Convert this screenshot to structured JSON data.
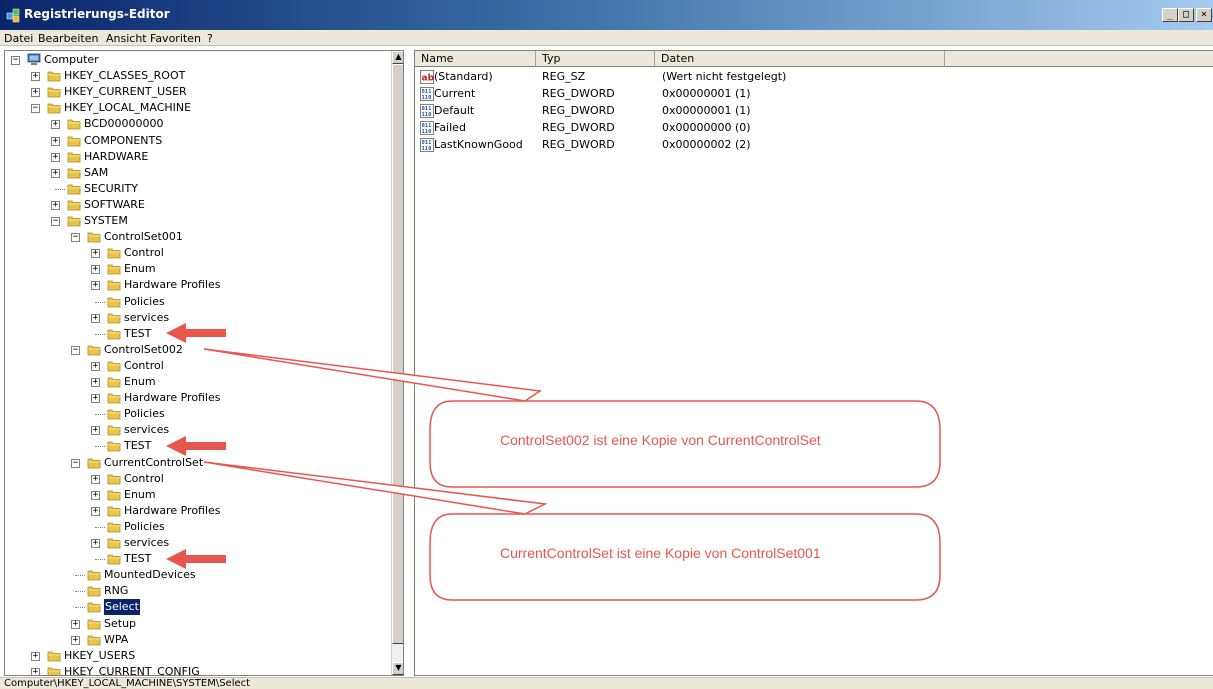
{
  "window": {
    "title": "Registrierungs-Editor",
    "min_label": "_",
    "max_label": "□",
    "close_label": "×"
  },
  "menu": [
    "Datei",
    "Bearbeiten",
    "Ansicht",
    "Favoriten",
    "?"
  ],
  "tree": [
    {
      "label": "Computer",
      "level": 0,
      "expander": "−",
      "icon": "computer-icon"
    },
    {
      "label": "HKEY_CLASSES_ROOT",
      "level": 1,
      "expander": "+"
    },
    {
      "label": "HKEY_CURRENT_USER",
      "level": 1,
      "expander": "+"
    },
    {
      "label": "HKEY_LOCAL_MACHINE",
      "level": 1,
      "expander": "−"
    },
    {
      "label": "BCD00000000",
      "level": 2,
      "expander": "+"
    },
    {
      "label": "COMPONENTS",
      "level": 2,
      "expander": "+"
    },
    {
      "label": "HARDWARE",
      "level": 2,
      "expander": "+"
    },
    {
      "label": "SAM",
      "level": 2,
      "expander": "+"
    },
    {
      "label": "SECURITY",
      "level": 2,
      "expander": ""
    },
    {
      "label": "SOFTWARE",
      "level": 2,
      "expander": "+"
    },
    {
      "label": "SYSTEM",
      "level": 2,
      "expander": "−"
    },
    {
      "label": "ControlSet001",
      "level": 3,
      "expander": "−"
    },
    {
      "label": "Control",
      "level": 4,
      "expander": "+"
    },
    {
      "label": "Enum",
      "level": 4,
      "expander": "+"
    },
    {
      "label": "Hardware Profiles",
      "level": 4,
      "expander": "+"
    },
    {
      "label": "Policies",
      "level": 4,
      "expander": ""
    },
    {
      "label": "services",
      "level": 4,
      "expander": "+"
    },
    {
      "label": "TEST",
      "level": 4,
      "expander": ""
    },
    {
      "label": "ControlSet002",
      "level": 3,
      "expander": "−"
    },
    {
      "label": "Control",
      "level": 4,
      "expander": "+"
    },
    {
      "label": "Enum",
      "level": 4,
      "expander": "+"
    },
    {
      "label": "Hardware Profiles",
      "level": 4,
      "expander": "+"
    },
    {
      "label": "Policies",
      "level": 4,
      "expander": ""
    },
    {
      "label": "services",
      "level": 4,
      "expander": "+"
    },
    {
      "label": "TEST",
      "level": 4,
      "expander": ""
    },
    {
      "label": "CurrentControlSet",
      "level": 3,
      "expander": "−"
    },
    {
      "label": "Control",
      "level": 4,
      "expander": "+"
    },
    {
      "label": "Enum",
      "level": 4,
      "expander": "+"
    },
    {
      "label": "Hardware Profiles",
      "level": 4,
      "expander": "+"
    },
    {
      "label": "Policies",
      "level": 4,
      "expander": ""
    },
    {
      "label": "services",
      "level": 4,
      "expander": "+"
    },
    {
      "label": "TEST",
      "level": 4,
      "expander": ""
    },
    {
      "label": "MountedDevices",
      "level": 3,
      "expander": ""
    },
    {
      "label": "RNG",
      "level": 3,
      "expander": ""
    },
    {
      "label": "Select",
      "level": 3,
      "expander": "",
      "selected": true
    },
    {
      "label": "Setup",
      "level": 3,
      "expander": "+"
    },
    {
      "label": "WPA",
      "level": 3,
      "expander": "+"
    },
    {
      "label": "HKEY_USERS",
      "level": 1,
      "expander": "+"
    },
    {
      "label": "HKEY_CURRENT_CONFIG",
      "level": 1,
      "expander": "+"
    }
  ],
  "list": {
    "columns": [
      "Name",
      "Typ",
      "Daten"
    ],
    "rows": [
      {
        "name": "(Standard)",
        "type": "REG_SZ",
        "data": "(Wert nicht festgelegt)",
        "icon": "string-value-icon"
      },
      {
        "name": "Current",
        "type": "REG_DWORD",
        "data": "0x00000001 (1)",
        "icon": "dword-value-icon"
      },
      {
        "name": "Default",
        "type": "REG_DWORD",
        "data": "0x00000001 (1)",
        "icon": "dword-value-icon"
      },
      {
        "name": "Failed",
        "type": "REG_DWORD",
        "data": "0x00000000 (0)",
        "icon": "dword-value-icon"
      },
      {
        "name": "LastKnownGood",
        "type": "REG_DWORD",
        "data": "0x00000002 (2)",
        "icon": "dword-value-icon"
      }
    ]
  },
  "status": "Computer\\HKEY_LOCAL_MACHINE\\SYSTEM\\Select",
  "annotations": {
    "callout1": "ControlSet002 ist eine Kopie von CurrentControlSet",
    "callout2": "CurrentControlSet ist eine Kopie von ControlSet001",
    "color": "#e8574d"
  },
  "colors": {
    "titlebar_start": "#0a246a",
    "selection": "#0a246a",
    "folder": "#e8c44a",
    "annotation": "#e8574d"
  }
}
